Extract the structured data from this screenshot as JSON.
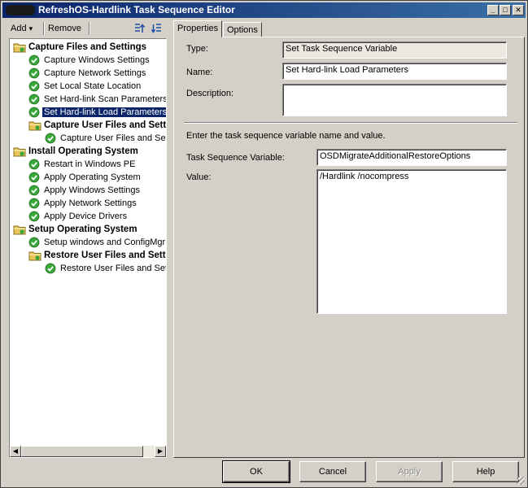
{
  "window": {
    "title": "RefreshOS-Hardlink Task Sequence Editor",
    "controls": {
      "minimize": "_",
      "maximize": "□",
      "close": "✕"
    }
  },
  "toolbar": {
    "add_label": "Add",
    "add_arrow": "▾",
    "remove_label": "Remove"
  },
  "tree": {
    "items": [
      {
        "label": "Capture Files and Settings",
        "type": "group",
        "bold": true,
        "level": 0
      },
      {
        "label": "Capture Windows Settings",
        "type": "step",
        "bold": false,
        "level": 1
      },
      {
        "label": "Capture Network Settings",
        "type": "step",
        "bold": false,
        "level": 1
      },
      {
        "label": "Set Local State Location",
        "type": "step",
        "bold": false,
        "level": 1
      },
      {
        "label": "Set Hard-link Scan Parameters",
        "type": "step",
        "bold": false,
        "level": 1
      },
      {
        "label": "Set Hard-link Load Parameters",
        "type": "step",
        "bold": false,
        "level": 1,
        "selected": true
      },
      {
        "label": "Capture User Files and Settings",
        "type": "group",
        "bold": true,
        "level": 1
      },
      {
        "label": "Capture User Files and Settings",
        "type": "step",
        "bold": false,
        "level": 2
      },
      {
        "label": "Install Operating System",
        "type": "group",
        "bold": true,
        "level": 0
      },
      {
        "label": "Restart in Windows PE",
        "type": "step",
        "bold": false,
        "level": 1
      },
      {
        "label": "Apply Operating System",
        "type": "step",
        "bold": false,
        "level": 1
      },
      {
        "label": "Apply Windows Settings",
        "type": "step",
        "bold": false,
        "level": 1
      },
      {
        "label": "Apply Network Settings",
        "type": "step",
        "bold": false,
        "level": 1
      },
      {
        "label": "Apply Device Drivers",
        "type": "step",
        "bold": false,
        "level": 1
      },
      {
        "label": "Setup Operating System",
        "type": "group",
        "bold": true,
        "level": 0
      },
      {
        "label": "Setup windows and ConfigMgr",
        "type": "step",
        "bold": false,
        "level": 1
      },
      {
        "label": "Restore User Files and Settings",
        "type": "group",
        "bold": true,
        "level": 1
      },
      {
        "label": "Restore User Files and Settings",
        "type": "step",
        "bold": false,
        "level": 2
      }
    ],
    "scroll_left": "◀",
    "scroll_right": "▶"
  },
  "tabs": [
    {
      "label": "Properties",
      "active": true
    },
    {
      "label": "Options",
      "active": false
    }
  ],
  "properties": {
    "type_label": "Type:",
    "type_value": "Set Task Sequence Variable",
    "name_label": "Name:",
    "name_value": "Set Hard-link Load Parameters",
    "description_label": "Description:",
    "description_value": "",
    "instruction": "Enter the task sequence variable name and value.",
    "variable_label": "Task Sequence Variable:",
    "variable_value": "OSDMigrateAdditionalRestoreOptions",
    "value_label": "Value:",
    "value_value": "/Hardlink /nocompress"
  },
  "buttons": {
    "ok": "OK",
    "cancel": "Cancel",
    "apply": "Apply",
    "help": "Help"
  },
  "colors": {
    "titlebar_start": "#0a246a",
    "selection": "#0a246a",
    "step_check": "#3aa63a",
    "folder": "#e8c65a"
  }
}
